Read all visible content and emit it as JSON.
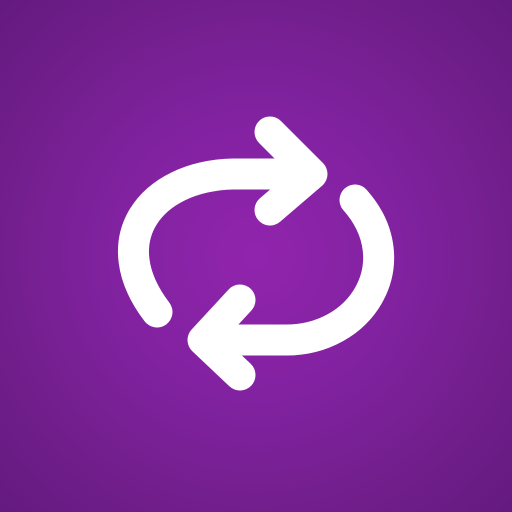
{
  "icon": {
    "name": "repeat-icon",
    "description_shape": "two curved arrows forming a loop",
    "background_color_center": "#9124ad",
    "background_color_edge": "#641a80",
    "glyph_color": "#ffffff"
  }
}
